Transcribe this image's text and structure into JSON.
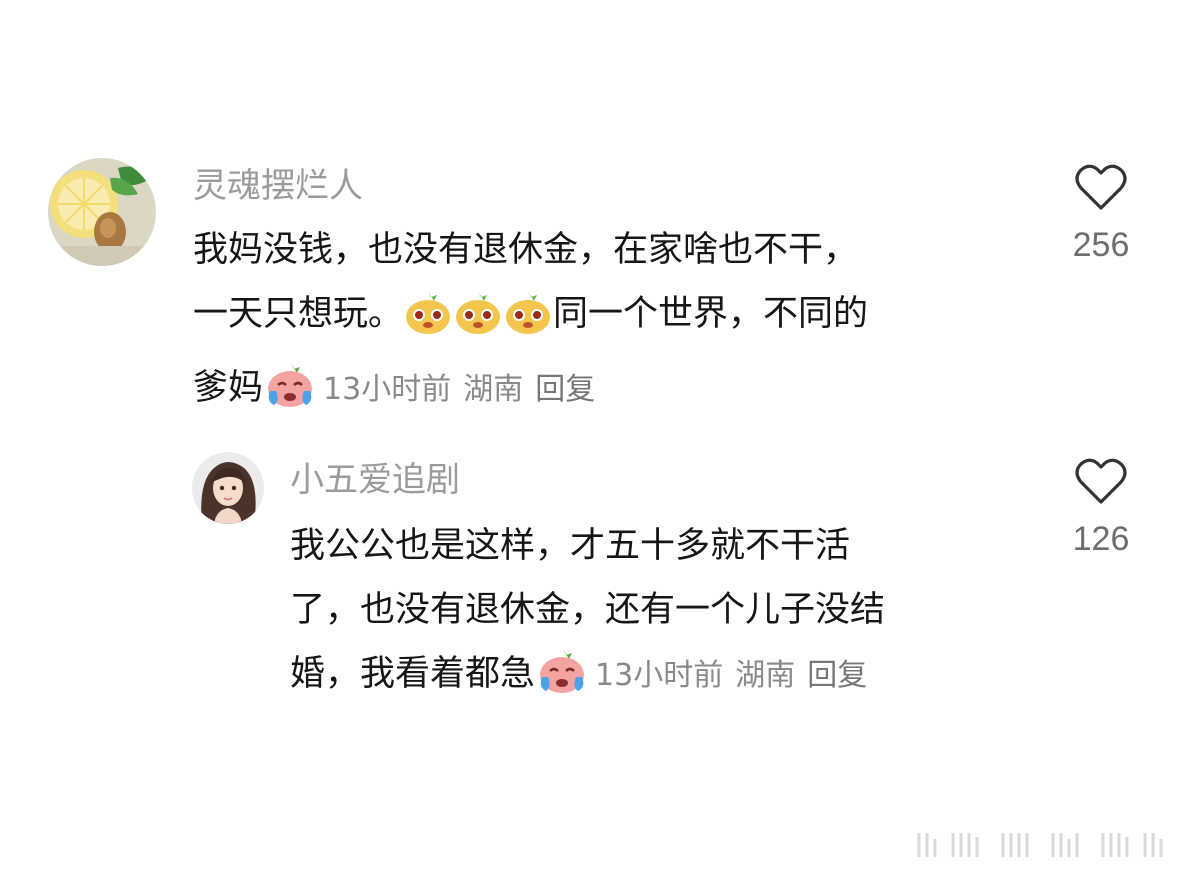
{
  "comments": [
    {
      "username": "灵魂摆烂人",
      "text1": "我妈没钱，也没有退休金，在家啥也不干，",
      "text2": "一天只想玩。",
      "text3": "同一个世界，不同的",
      "text4": "爹妈",
      "emoji_mid": [
        "cheeky-face-emoji",
        "cheeky-face-emoji",
        "cheeky-face-emoji"
      ],
      "emoji_end": "crying-face-emoji",
      "time": "13小时前",
      "location": "湖南",
      "reply": "回复",
      "likes": "256"
    },
    {
      "username": "小五爱追剧",
      "text1": "我公公也是这样，才五十多就不干活",
      "text2": "了，也没有退休金，还有一个儿子没结",
      "text3": "婚，我看着都急",
      "emoji_end": "crying-face-emoji",
      "time": "13小时前",
      "location": "湖南",
      "reply": "回复",
      "likes": "126"
    }
  ],
  "icons": {
    "like": "heart-outline-icon"
  },
  "colors": {
    "username": "#9b9b9b",
    "text": "#161616",
    "meta": "#8a8a8a"
  }
}
